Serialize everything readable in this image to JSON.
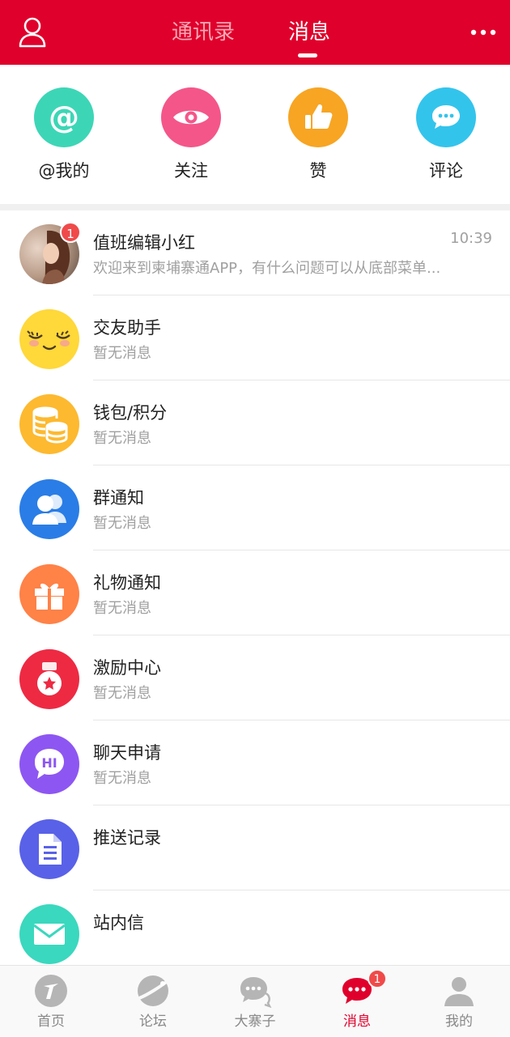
{
  "header": {
    "tabs": [
      {
        "label": "通讯录"
      },
      {
        "label": "消息"
      }
    ],
    "active_tab": "消息",
    "bg_color": "#E0002C"
  },
  "quick_actions": [
    {
      "label": "@我的",
      "icon": "at-icon",
      "color": "#3CD6B6"
    },
    {
      "label": "关注",
      "icon": "eye-icon",
      "color": "#F4568A"
    },
    {
      "label": "赞",
      "icon": "thumbs-up-icon",
      "color": "#F7A523"
    },
    {
      "label": "评论",
      "icon": "comment-bubble-icon",
      "color": "#33C4EC"
    }
  ],
  "messages": [
    {
      "title": "值班编辑小红",
      "subtitle": "欢迎来到柬埔寨通APP，有什么问题可以从底部菜单...",
      "time": "10:39",
      "badge": "1",
      "icon": "user-photo-avatar"
    },
    {
      "title": "交友助手",
      "subtitle": "暂无消息",
      "icon": "smiley-face-icon",
      "color": "#FFD83A"
    },
    {
      "title": "钱包/积分",
      "subtitle": "暂无消息",
      "icon": "coins-icon",
      "color": "#FDB92F"
    },
    {
      "title": "群通知",
      "subtitle": "暂无消息",
      "icon": "group-users-icon",
      "color": "#2A7DE6"
    },
    {
      "title": "礼物通知",
      "subtitle": "暂无消息",
      "icon": "gift-icon",
      "color": "#FF8247"
    },
    {
      "title": "激励中心",
      "subtitle": "暂无消息",
      "icon": "medal-icon",
      "color": "#EE2A43"
    },
    {
      "title": "聊天申请",
      "subtitle": "暂无消息",
      "icon": "hi-chat-icon",
      "color": "#8D56F2"
    },
    {
      "title": "推送记录",
      "subtitle": "",
      "icon": "document-icon",
      "color": "#5961E8"
    },
    {
      "title": "站内信",
      "subtitle": "",
      "icon": "mail-icon",
      "color": "#3AD8BE"
    }
  ],
  "bottom_nav": [
    {
      "label": "首页",
      "icon": "home-logo-icon"
    },
    {
      "label": "论坛",
      "icon": "planet-icon"
    },
    {
      "label": "大寨子",
      "icon": "chat-bubbles-icon"
    },
    {
      "label": "消息",
      "icon": "message-icon",
      "active": true,
      "badge": "1"
    },
    {
      "label": "我的",
      "icon": "profile-icon"
    }
  ]
}
